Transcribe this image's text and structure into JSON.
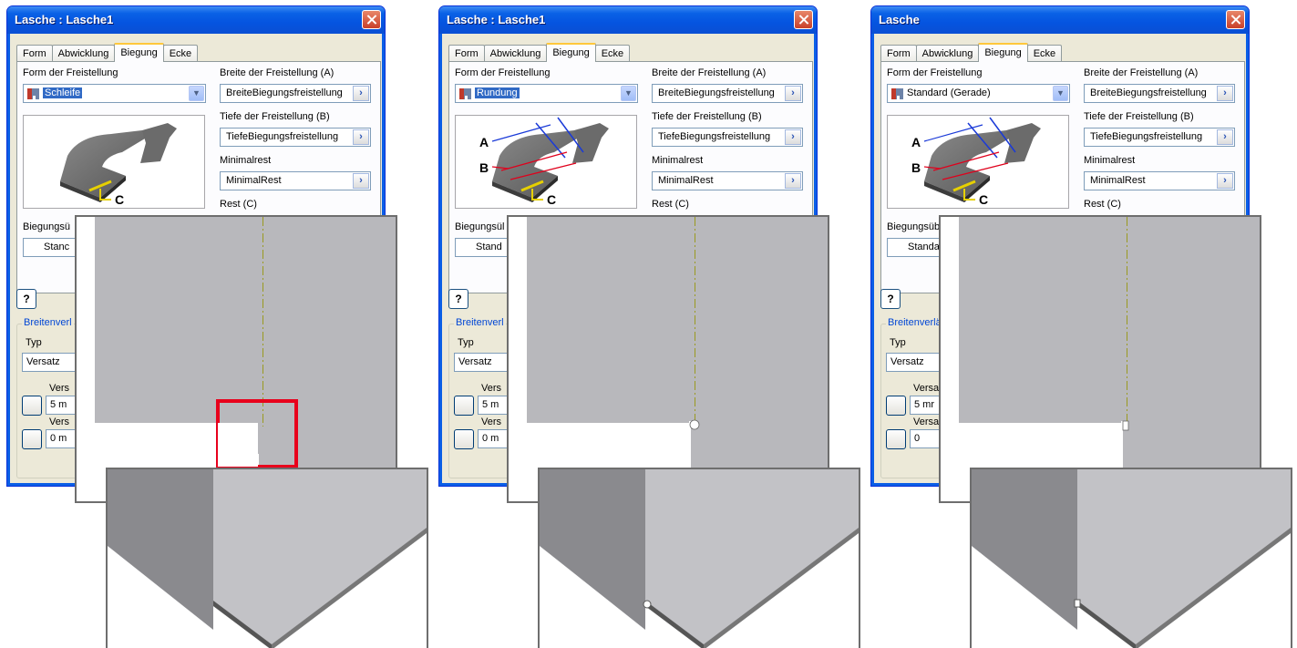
{
  "panels": [
    {
      "title": "Lasche : Lasche1",
      "tabs": [
        "Form",
        "Abwicklung",
        "Biegung",
        "Ecke"
      ],
      "active_tab": "Biegung",
      "relief_shape_label": "Form der Freistellung",
      "relief_shape_value": "Schleife",
      "width_label": "Breite der Freistellung (A)",
      "width_value": "BreiteBiegungsfreistellung",
      "depth_label": "Tiefe der Freistellung (B)",
      "depth_value": "TiefeBiegungsfreistellung",
      "minimal_label": "Minimalrest",
      "minimal_value": "MinimalRest",
      "rest_label": "Rest (C)",
      "transition_label": "Biegungsü",
      "transition_value": "Stanc",
      "help_label": "?",
      "group_label": "Breitenverl",
      "type_label": "Typ",
      "type_value": "Versatz",
      "offset1_label": "Vers",
      "offset1_value": "5 m",
      "offset2_label": "Vers",
      "offset2_value": "0 m",
      "diagram_letters": [
        "C"
      ],
      "highlight": true
    },
    {
      "title": "Lasche : Lasche1",
      "tabs": [
        "Form",
        "Abwicklung",
        "Biegung",
        "Ecke"
      ],
      "active_tab": "Biegung",
      "relief_shape_label": "Form der Freistellung",
      "relief_shape_value": "Rundung",
      "width_label": "Breite der Freistellung (A)",
      "width_value": "BreiteBiegungsfreistellung",
      "depth_label": "Tiefe der Freistellung (B)",
      "depth_value": "TiefeBiegungsfreistellung",
      "minimal_label": "Minimalrest",
      "minimal_value": "MinimalRest",
      "rest_label": "Rest (C)",
      "transition_label": "Biegungsül",
      "transition_value": "Stand",
      "help_label": "?",
      "group_label": "Breitenverl",
      "type_label": "Typ",
      "type_value": "Versatz",
      "offset1_label": "Vers",
      "offset1_value": "5 m",
      "offset2_label": "Vers",
      "offset2_value": "0 m",
      "diagram_letters": [
        "A",
        "B",
        "C"
      ],
      "highlight": false
    },
    {
      "title": "Lasche",
      "tabs": [
        "Form",
        "Abwicklung",
        "Biegung",
        "Ecke"
      ],
      "active_tab": "Biegung",
      "relief_shape_label": "Form der Freistellung",
      "relief_shape_value": "Standard (Gerade)",
      "width_label": "Breite der Freistellung (A)",
      "width_value": "BreiteBiegungsfreistellung",
      "depth_label": "Tiefe der Freistellung (B)",
      "depth_value": "TiefeBiegungsfreistellung",
      "minimal_label": "Minimalrest",
      "minimal_value": "MinimalRest",
      "rest_label": "Rest (C)",
      "transition_label": "Biegungsüb",
      "transition_value": "Standa",
      "help_label": "?",
      "group_label": "Breitenverlä",
      "type_label": "Typ",
      "type_value": "Versatz",
      "offset1_label": "Versa",
      "offset1_value": "5 mr",
      "offset2_label": "Versa",
      "offset2_value": "0",
      "diagram_letters": [
        "A",
        "B",
        "C"
      ],
      "highlight": false
    }
  ],
  "colors": {
    "titlebar": "#0a62e6",
    "dialog_bg": "#ece9d8",
    "sheet_gray": "#b8b8bc",
    "sheet_dark": "#8a8a8e",
    "bend_line": "#9a9a20",
    "highlight_red": "#e8001c"
  },
  "icons": [
    "close-icon",
    "dropdown-arrow-icon",
    "parameter-arrow-icon",
    "help-icon",
    "select-arrow-icon",
    "relief-shape-icon"
  ]
}
